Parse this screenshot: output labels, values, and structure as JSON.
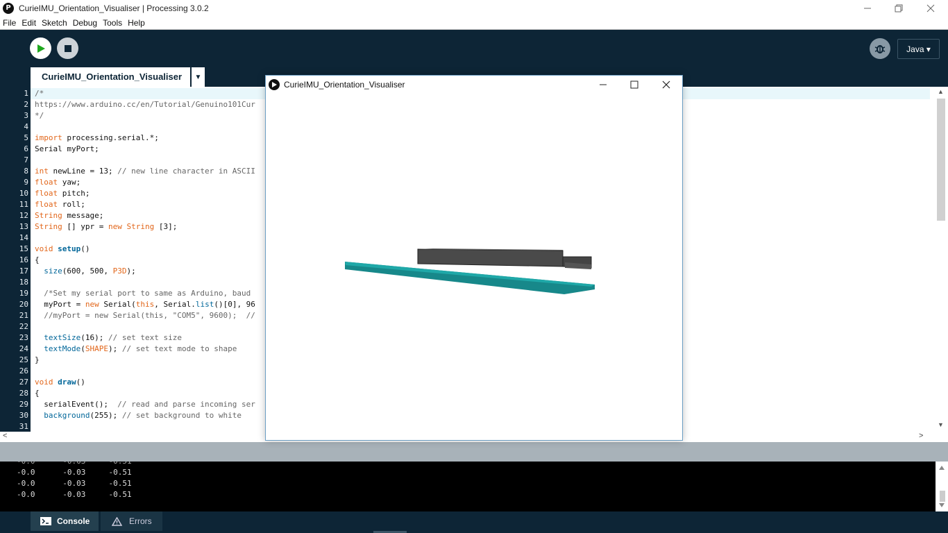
{
  "window": {
    "title": "CurieIMU_Orientation_Visualiser | Processing 3.0.2",
    "app_icon_glyph": "P",
    "controls": [
      "minimize-icon",
      "restore-icon",
      "close-icon"
    ]
  },
  "menu": [
    "File",
    "Edit",
    "Sketch",
    "Debug",
    "Tools",
    "Help"
  ],
  "toolbar": {
    "run_icon": "play-icon",
    "stop_icon": "stop-icon",
    "debug_icon": "debugger-icon",
    "mode_label": "Java ▾"
  },
  "tab": {
    "label": "CurieIMU_Orientation_Visualiser",
    "menu_glyph": "▼"
  },
  "editor": {
    "lines": [
      [
        {
          "t": "/*",
          "c": "c"
        }
      ],
      [
        {
          "t": "https://www.arduino.cc/en/Tutorial/Genuino101Cur",
          "c": "c"
        }
      ],
      [
        {
          "t": "*/",
          "c": "c"
        }
      ],
      [],
      [
        {
          "t": "import",
          "c": "k"
        },
        {
          "t": " processing.serial.*;",
          "c": ""
        }
      ],
      [
        {
          "t": "Serial myPort;",
          "c": ""
        }
      ],
      [],
      [
        {
          "t": "int",
          "c": "k"
        },
        {
          "t": " newLine = 13; ",
          "c": ""
        },
        {
          "t": "// new line character in ASCII",
          "c": "c"
        }
      ],
      [
        {
          "t": "float",
          "c": "k"
        },
        {
          "t": " yaw;",
          "c": ""
        }
      ],
      [
        {
          "t": "float",
          "c": "k"
        },
        {
          "t": " pitch;",
          "c": ""
        }
      ],
      [
        {
          "t": "float",
          "c": "k"
        },
        {
          "t": " roll;",
          "c": ""
        }
      ],
      [
        {
          "t": "String",
          "c": "k"
        },
        {
          "t": " message;",
          "c": ""
        }
      ],
      [
        {
          "t": "String",
          "c": "k"
        },
        {
          "t": " [] ypr = ",
          "c": ""
        },
        {
          "t": "new",
          "c": "k"
        },
        {
          "t": " ",
          "c": ""
        },
        {
          "t": "String",
          "c": "k"
        },
        {
          "t": " [3];",
          "c": ""
        }
      ],
      [],
      [
        {
          "t": "void",
          "c": "k"
        },
        {
          "t": " ",
          "c": ""
        },
        {
          "t": "setup",
          "c": "f"
        },
        {
          "t": "()",
          "c": ""
        }
      ],
      [
        {
          "t": "{",
          "c": ""
        }
      ],
      [
        {
          "t": "  ",
          "c": ""
        },
        {
          "t": "size",
          "c": "b"
        },
        {
          "t": "(600, 500, ",
          "c": ""
        },
        {
          "t": "P3D",
          "c": "k"
        },
        {
          "t": ");",
          "c": ""
        }
      ],
      [],
      [
        {
          "t": "  /*Set my serial port to same as Arduino, baud",
          "c": "c"
        }
      ],
      [
        {
          "t": "  myPort = ",
          "c": ""
        },
        {
          "t": "new",
          "c": "k"
        },
        {
          "t": " Serial(",
          "c": ""
        },
        {
          "t": "this",
          "c": "k"
        },
        {
          "t": ", Serial.",
          "c": ""
        },
        {
          "t": "list",
          "c": "b"
        },
        {
          "t": "()[0], 96",
          "c": ""
        }
      ],
      [
        {
          "t": "  //myPort = new Serial(this, \"COM5\", 9600);  //",
          "c": "c"
        }
      ],
      [],
      [
        {
          "t": "  ",
          "c": ""
        },
        {
          "t": "textSize",
          "c": "b"
        },
        {
          "t": "(16); ",
          "c": ""
        },
        {
          "t": "// set text size",
          "c": "c"
        }
      ],
      [
        {
          "t": "  ",
          "c": ""
        },
        {
          "t": "textMode",
          "c": "b"
        },
        {
          "t": "(",
          "c": ""
        },
        {
          "t": "SHAPE",
          "c": "k"
        },
        {
          "t": "); ",
          "c": ""
        },
        {
          "t": "// set text mode to shape",
          "c": "c"
        }
      ],
      [
        {
          "t": "}",
          "c": ""
        }
      ],
      [],
      [
        {
          "t": "void",
          "c": "k"
        },
        {
          "t": " ",
          "c": ""
        },
        {
          "t": "draw",
          "c": "f"
        },
        {
          "t": "()",
          "c": ""
        }
      ],
      [
        {
          "t": "{",
          "c": ""
        }
      ],
      [
        {
          "t": "  serialEvent();  ",
          "c": ""
        },
        {
          "t": "// read and parse incoming ser",
          "c": "c"
        }
      ],
      [
        {
          "t": "  ",
          "c": ""
        },
        {
          "t": "background",
          "c": "b"
        },
        {
          "t": "(255); ",
          "c": ""
        },
        {
          "t": "// set background to white",
          "c": "c"
        }
      ],
      []
    ],
    "scroll_left_glyph": "<",
    "scroll_right_glyph": ">",
    "scroll_up_glyph": "▲",
    "scroll_down_glyph": "▼"
  },
  "console": {
    "lines": [
      "-0.0      -0.03     -0.51",
      "-0.0      -0.03     -0.51",
      "-0.0      -0.03     -0.51",
      "-0.0      -0.03     -0.51"
    ]
  },
  "bottom_tabs": [
    {
      "label": "Console",
      "icon": "console-icon"
    },
    {
      "label": "Errors",
      "icon": "warning-icon"
    }
  ],
  "sketch_window": {
    "title": "CurieIMU_Orientation_Visualiser",
    "controls": [
      "minimize-icon",
      "maximize-icon",
      "close-icon"
    ]
  },
  "colors": {
    "toolbar_bg": "#0d2536",
    "keyword": "#e2661a",
    "function_blue": "#006699",
    "comment": "#666666",
    "board_teal": "#1a9a9a",
    "chip_gray": "#444444"
  }
}
